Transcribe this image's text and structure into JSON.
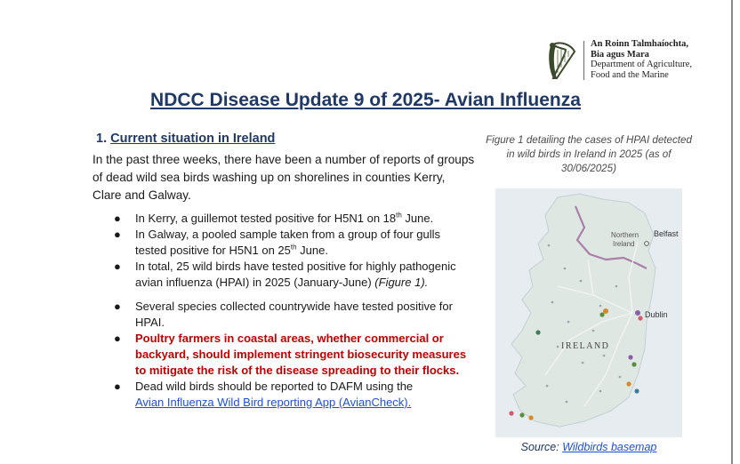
{
  "header": {
    "org_line1": "An Roinn Talmhaíochta,",
    "org_line2": "Bia agus Mara",
    "org_line3": "Department of Agriculture,",
    "org_line4": "Food and the Marine",
    "logo_icon": "harp-icon"
  },
  "title": "NDCC Disease Update 9 of 2025- Avian Influenza",
  "section": {
    "number": "1.",
    "title": "Current situation in Ireland",
    "intro": "In the past three weeks, there have been a number of reports of groups of dead wild sea birds washing up on shorelines in counties Kerry, Clare and Galway."
  },
  "bullets": {
    "b1_pre": "In Kerry, a guillemot tested positive for H5N1 on 18",
    "b1_sup": "th",
    "b1_post": " June.",
    "b2_pre": "In Galway, a pooled sample taken from a group of four gulls tested positive for H5N1 on 25",
    "b2_sup": "th",
    "b2_post": " June.",
    "b3_pre": "In total, 25 wild birds have tested positive for highly pathogenic avian influenza (HPAI) in 2025 (January-June) ",
    "b3_ref": "(Figure 1).",
    "b4": "Several species collected countrywide have tested positive for HPAI.",
    "b5": "Poultry farmers in coastal areas, whether commercial or backyard, should implement stringent biosecurity measures to mitigate the risk of the disease spreading to their flocks.",
    "b6_pre": "Dead wild birds should be reported to DAFM using the",
    "b6_link": "Avian Influenza Wild Bird reporting App (AvianCheck)."
  },
  "figure": {
    "caption": "Figure 1 detailing the cases of HPAI detected in wild birds in Ireland in 2025 (as of 30/06/2025)",
    "map_labels": {
      "northern1": "Northern",
      "northern2": "Ireland",
      "belfast": "Belfast",
      "dublin": "Dublin",
      "ireland": "IRELAND"
    },
    "source_prefix": "Source: ",
    "source_link": "Wildbirds basemap"
  },
  "colors": {
    "title": "#1f3864",
    "warning": "#c00000",
    "link": "#1f4fd6"
  }
}
